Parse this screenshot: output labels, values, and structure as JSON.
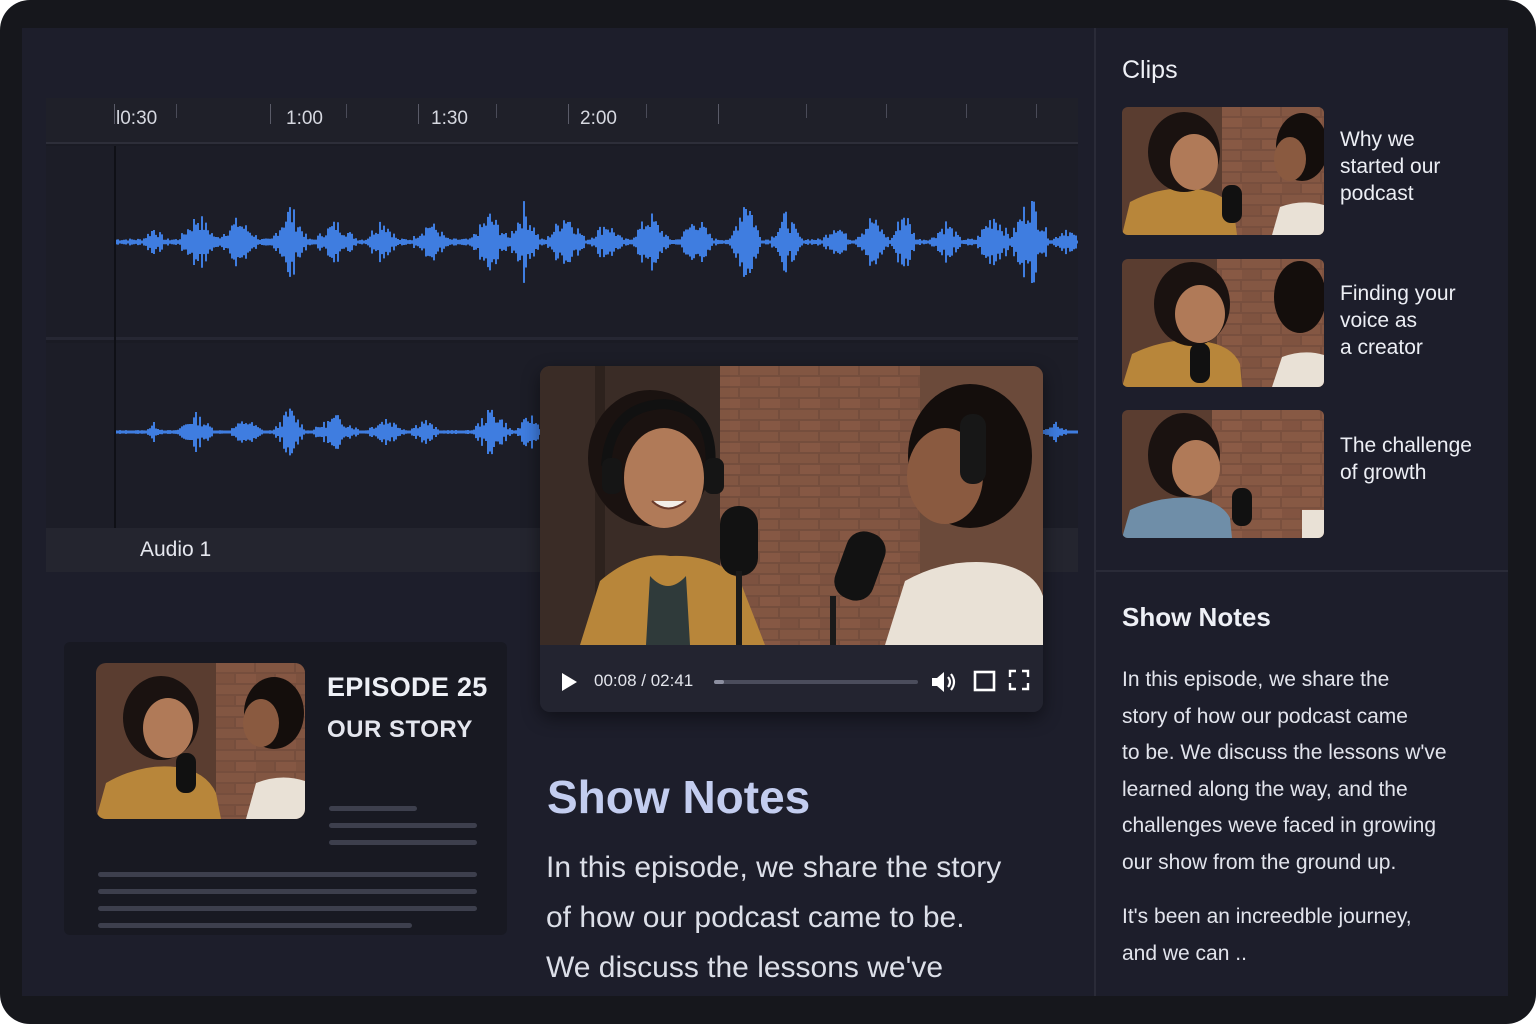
{
  "timeline": {
    "ruler_labels": [
      "l0:30",
      "1:00",
      "1:30",
      "2:00"
    ],
    "track_label": "Audio 1"
  },
  "player": {
    "time": "00:08 / 02:41",
    "progress": 0.05,
    "play_icon": "play-icon",
    "volume_icon": "volume-icon",
    "square_icon": "square-icon",
    "fullscreen_icon": "fullscreen-icon"
  },
  "episode": {
    "number": "EPISODE 25",
    "title": "OUR STORY"
  },
  "main_notes": {
    "heading": "Show Notes",
    "lines": [
      "In this episode, we share the story",
      "of how our podcast came to be.",
      "We discuss the lessons we've"
    ]
  },
  "clips": {
    "heading": "Clips",
    "items": [
      {
        "title_lines": [
          "Why we",
          "started our",
          "podcast"
        ]
      },
      {
        "title_lines": [
          "Finding your",
          "voice as",
          "a creator"
        ]
      },
      {
        "title_lines": [
          "The challenge",
          "of growth"
        ]
      }
    ]
  },
  "side_notes": {
    "heading": "Show Notes",
    "lines": [
      "In this episode, we  share the",
      "story of how our podcast came",
      "to be. We discuss the lessons w've",
      "learned along the way, and the",
      "challenges weve faced in growing",
      "our show  from the ground up."
    ],
    "lines2": [
      "It's been an increedble journey,",
      "and we can .."
    ]
  },
  "colors": {
    "accent_blue": "#3f7de0",
    "heading_blue": "#c3cdef",
    "background": "#1d1e2b"
  }
}
